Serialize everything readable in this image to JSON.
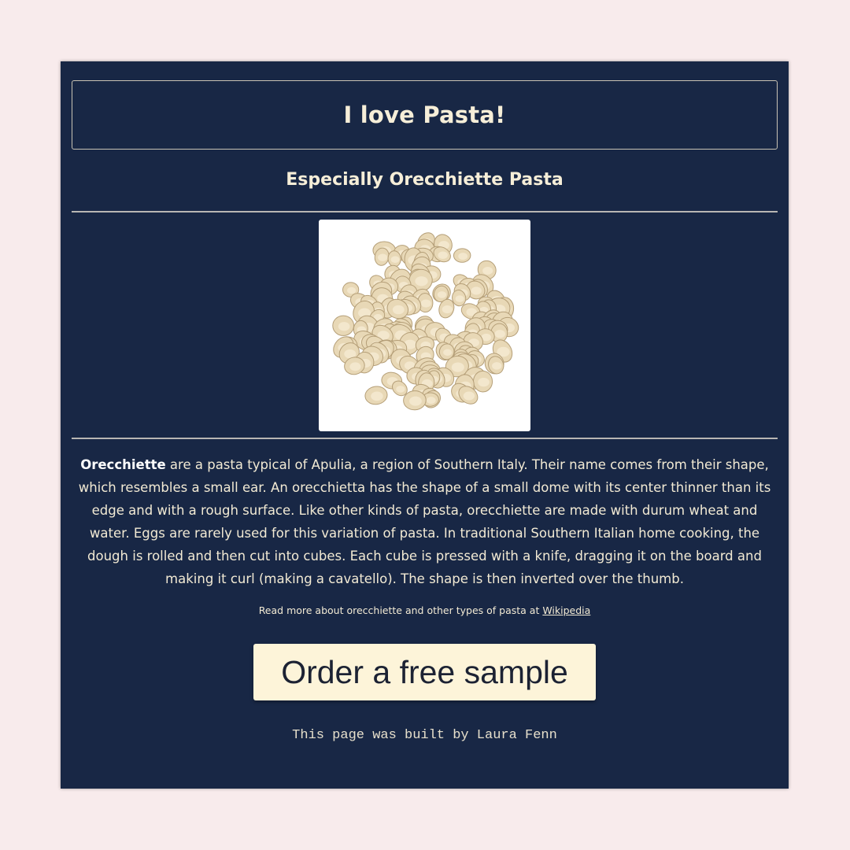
{
  "header": {
    "title": "I love Pasta!",
    "subtitle": "Especially Orecchiette Pasta"
  },
  "image": {
    "alt": "Orecchiette pasta",
    "icon": "pasta-photo"
  },
  "article": {
    "term": "Orecchiette",
    "text": " are a pasta typical of Apulia, a region of Southern Italy. Their name comes from their shape, which resembles a small ear. An orecchietta has the shape of a small dome with its center thinner than its edge and with a rough surface. Like other kinds of pasta, orecchiette are made with durum wheat and water. Eggs are rarely used for this variation of pasta. In traditional Southern Italian home cooking, the dough is rolled and then cut into cubes. Each cube is pressed with a knife, dragging it on the board and making it curl (making a cavatello). The shape is then inverted over the thumb."
  },
  "read_more": {
    "prefix": "Read more about orecchiette and other types of pasta at ",
    "link_label": "Wikipedia"
  },
  "cta": {
    "label": "Order a free sample"
  },
  "footer": {
    "text": "This page was built by Laura Fenn"
  },
  "colors": {
    "page_background": "#f8ebec",
    "card_background": "#182745",
    "text": "#f4ecd6",
    "button_background": "#fdf4d9"
  }
}
